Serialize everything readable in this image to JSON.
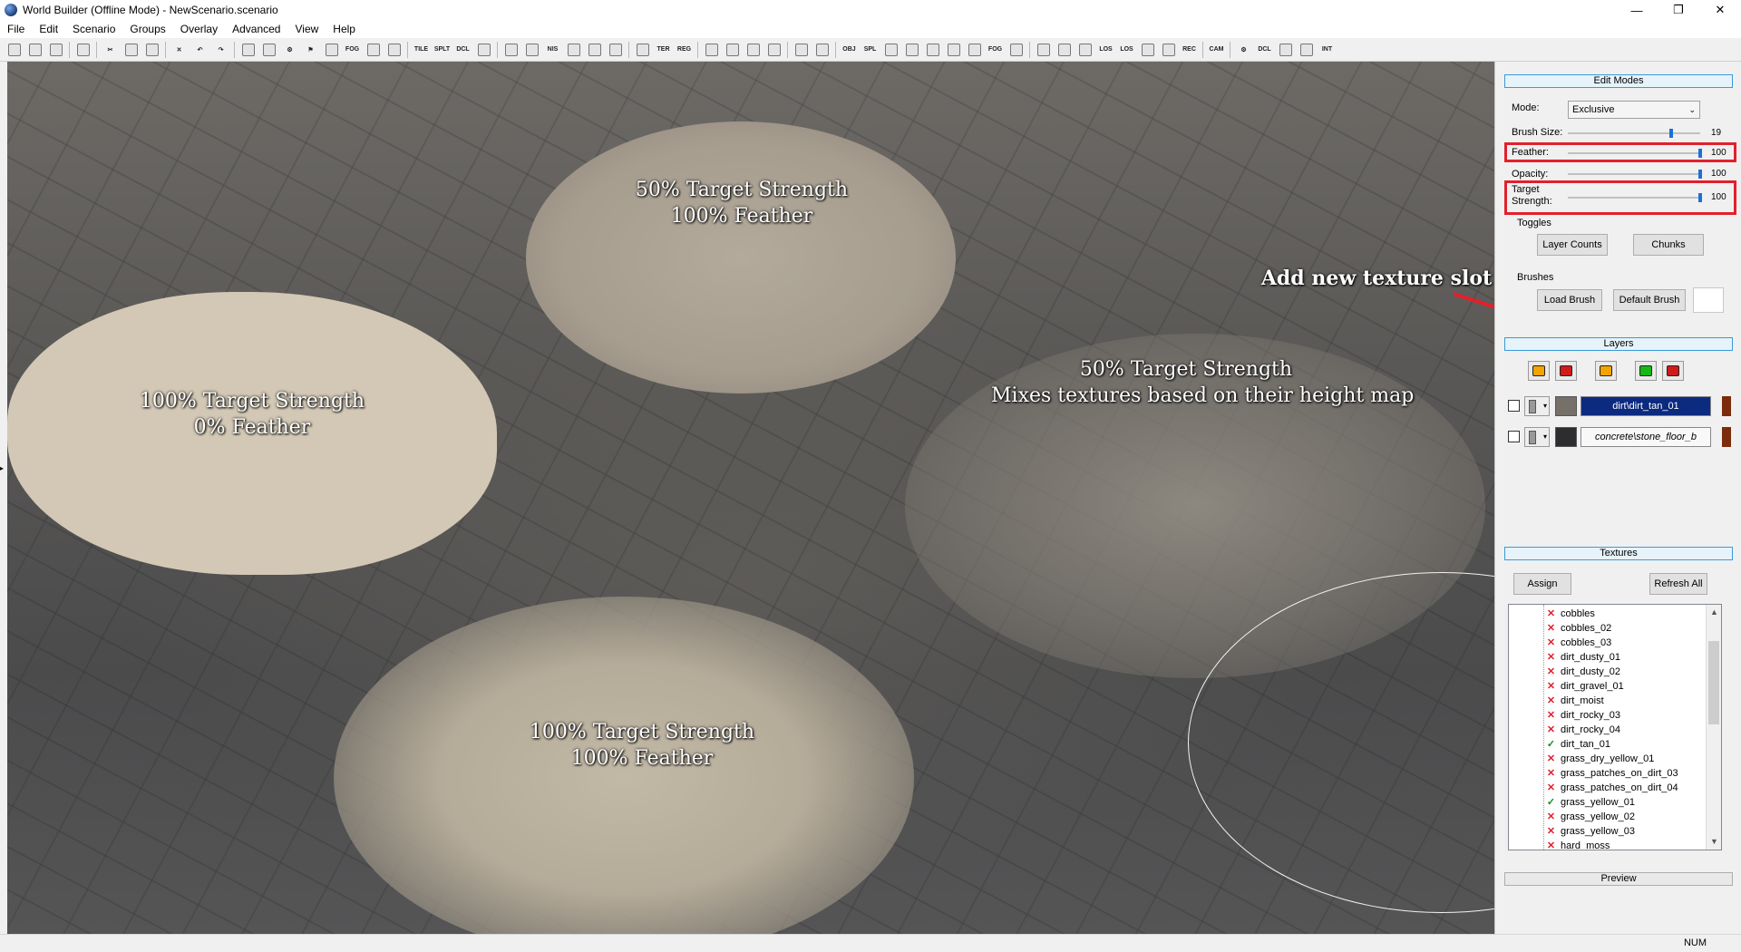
{
  "window": {
    "title": "World Builder (Offline Mode) - NewScenario.scenario",
    "controls": [
      "—",
      "❐",
      "✕"
    ]
  },
  "menu": [
    "File",
    "Edit",
    "Scenario",
    "Groups",
    "Overlay",
    "Advanced",
    "View",
    "Help"
  ],
  "toolbar": {
    "buttons": [
      {
        "icon": "new-file-icon",
        "glyph": ""
      },
      {
        "icon": "new-icon",
        "glyph": ""
      },
      {
        "icon": "open-folder-icon",
        "glyph": ""
      },
      {
        "icon": "save-icon",
        "glyph": ""
      },
      {
        "icon": "cut-icon",
        "glyph": "✂"
      },
      {
        "icon": "copy-icon",
        "glyph": ""
      },
      {
        "icon": "paste-icon",
        "glyph": ""
      },
      {
        "icon": "delete-icon",
        "glyph": "✕"
      },
      {
        "icon": "undo-icon",
        "glyph": "↶"
      },
      {
        "icon": "redo-icon",
        "glyph": "↷"
      },
      {
        "icon": "select-icon",
        "glyph": ""
      },
      {
        "icon": "tree-icon",
        "glyph": ""
      },
      {
        "icon": "gear-icon",
        "glyph": "⚙"
      },
      {
        "icon": "flag-icon",
        "glyph": "⚑"
      },
      {
        "icon": "bulb-icon",
        "glyph": ""
      },
      {
        "icon": "fog-icon",
        "glyph": "FOG"
      },
      {
        "icon": "paint-icon",
        "glyph": ""
      },
      {
        "icon": "soldier-icon",
        "glyph": ""
      },
      {
        "icon": "tile-icon",
        "glyph": "TILE"
      },
      {
        "icon": "split-icon",
        "glyph": "SPLT"
      },
      {
        "icon": "decal-icon",
        "glyph": "DCL"
      },
      {
        "icon": "color-wheel-icon",
        "glyph": ""
      },
      {
        "icon": "road-icon",
        "glyph": ""
      },
      {
        "icon": "water-icon",
        "glyph": ""
      },
      {
        "icon": "nis-icon",
        "glyph": "NIS"
      },
      {
        "icon": "wind-icon",
        "glyph": ""
      },
      {
        "icon": "splat-icon",
        "glyph": ""
      },
      {
        "icon": "chart-icon",
        "glyph": ""
      },
      {
        "icon": "spline-icon",
        "glyph": ""
      },
      {
        "icon": "terrain-icon",
        "glyph": "TER"
      },
      {
        "icon": "region-icon",
        "glyph": "REG"
      },
      {
        "icon": "frame-icon",
        "glyph": ""
      },
      {
        "icon": "grid-icon",
        "glyph": ""
      },
      {
        "icon": "marker-icon",
        "glyph": ""
      },
      {
        "icon": "marker2-icon",
        "glyph": ""
      },
      {
        "icon": "map-icon",
        "glyph": ""
      },
      {
        "icon": "table-icon",
        "glyph": ""
      },
      {
        "icon": "object-icon",
        "glyph": "OBJ"
      },
      {
        "icon": "spline-layer-icon",
        "glyph": "SPL"
      },
      {
        "icon": "road-layer-icon",
        "glyph": ""
      },
      {
        "icon": "pattern-icon",
        "glyph": ""
      },
      {
        "icon": "heightmap-icon",
        "glyph": ""
      },
      {
        "icon": "mountain-icon",
        "glyph": ""
      },
      {
        "icon": "landscape-icon",
        "glyph": ""
      },
      {
        "icon": "fog-layer-icon",
        "glyph": "FOG"
      },
      {
        "icon": "splash-icon",
        "glyph": ""
      },
      {
        "icon": "shield-icon",
        "glyph": ""
      },
      {
        "icon": "target-icon",
        "glyph": ""
      },
      {
        "icon": "circle-target-icon",
        "glyph": ""
      },
      {
        "icon": "los-icon",
        "glyph": "LOS"
      },
      {
        "icon": "los2-icon",
        "glyph": "LOS"
      },
      {
        "icon": "flag2-icon",
        "glyph": ""
      },
      {
        "icon": "badge-icon",
        "glyph": ""
      },
      {
        "icon": "rec-icon",
        "glyph": "REC"
      },
      {
        "icon": "cam-icon",
        "glyph": "CAM"
      },
      {
        "icon": "settings-icon",
        "glyph": "⚙"
      },
      {
        "icon": "decal-layer-icon",
        "glyph": "DCL"
      },
      {
        "icon": "bulb2-icon",
        "glyph": ""
      },
      {
        "icon": "medal-icon",
        "glyph": ""
      },
      {
        "icon": "int-icon",
        "glyph": "INT"
      }
    ]
  },
  "viewport": {
    "annotations": [
      {
        "line1": "50% Target Strength",
        "line2": "100% Feather"
      },
      {
        "line1": "100% Target Strength",
        "line2": "0% Feather"
      },
      {
        "line1": "50% Target Strength",
        "line2": "Mixes textures based on their height map"
      },
      {
        "line1": "100% Target Strength",
        "line2": "100% Feather"
      }
    ],
    "callout": "Add new texture slot",
    "callout_color": "#e2202b"
  },
  "panel": {
    "edit_modes_title": "Edit Modes",
    "mode_label": "Mode:",
    "mode_value": "Exclusive",
    "brush_size_label": "Brush Size:",
    "brush_size_value": "19",
    "brush_size_fraction": 0.77,
    "feather_label": "Feather:",
    "feather_value": "100",
    "opacity_label": "Opacity:",
    "opacity_value": "100",
    "target_strength_label": "Target Strength:",
    "target_strength_value": "100",
    "toggles_label": "Toggles",
    "layer_counts_btn": "Layer Counts",
    "chunks_btn": "Chunks",
    "brushes_label": "Brushes",
    "load_brush_btn": "Load Brush",
    "default_brush_btn": "Default Brush",
    "layers_title": "Layers",
    "layer_icons": [
      {
        "name": "layer-add-icon",
        "color": "#f2a400"
      },
      {
        "name": "layer-remove-icon",
        "color": "#d11a1a"
      },
      {
        "name": "layer-duplicate-icon",
        "color": "#f2a400"
      },
      {
        "name": "layer-new-slot-icon",
        "color": "#16b816"
      },
      {
        "name": "layer-delete-icon",
        "color": "#d11a1a"
      }
    ],
    "layers": [
      {
        "name": "dirt\\dirt_tan_01",
        "swatch": "#77706a",
        "selected": true
      },
      {
        "name": "concrete\\stone_floor_b",
        "swatch": "#2d2d2f",
        "selected": false
      }
    ],
    "textures_title": "Textures",
    "assign_btn": "Assign",
    "refresh_all_btn": "Refresh All",
    "textures": [
      {
        "name": "cobbles",
        "status": "missing"
      },
      {
        "name": "cobbles_02",
        "status": "missing"
      },
      {
        "name": "cobbles_03",
        "status": "missing"
      },
      {
        "name": "dirt_dusty_01",
        "status": "missing"
      },
      {
        "name": "dirt_dusty_02",
        "status": "missing"
      },
      {
        "name": "dirt_gravel_01",
        "status": "missing"
      },
      {
        "name": "dirt_moist",
        "status": "missing"
      },
      {
        "name": "dirt_rocky_03",
        "status": "missing"
      },
      {
        "name": "dirt_rocky_04",
        "status": "missing"
      },
      {
        "name": "dirt_tan_01",
        "status": "ok"
      },
      {
        "name": "grass_dry_yellow_01",
        "status": "missing"
      },
      {
        "name": "grass_patches_on_dirt_03",
        "status": "missing"
      },
      {
        "name": "grass_patches_on_dirt_04",
        "status": "missing"
      },
      {
        "name": "grass_yellow_01",
        "status": "ok"
      },
      {
        "name": "grass_yellow_02",
        "status": "missing"
      },
      {
        "name": "grass_yellow_03",
        "status": "missing"
      },
      {
        "name": "hard_moss",
        "status": "missing"
      }
    ],
    "preview_title": "Preview"
  },
  "status": {
    "num": "NUM"
  }
}
